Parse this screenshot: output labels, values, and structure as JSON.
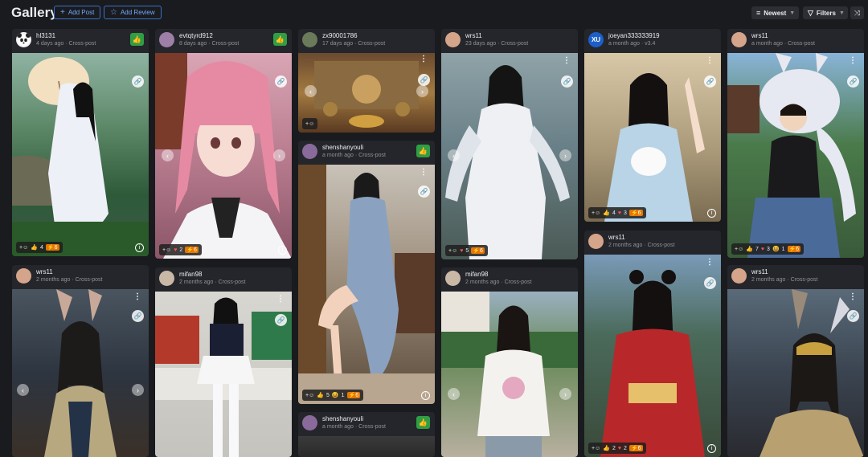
{
  "header": {
    "title": "Gallery",
    "add_post": "Add Post",
    "add_review": "Add Review",
    "sort": "Newest",
    "filters": "Filters"
  },
  "cards": [
    {
      "user": "hl3131",
      "meta": "4 days ago · Cross-post",
      "liked": true,
      "avatar": "panda-avatar",
      "reactions": {
        "thumbs": "4",
        "heart": "1",
        "buzz": "6"
      }
    },
    {
      "user": "evtqtyrd912",
      "meta": "8 days ago · Cross-post",
      "liked": true,
      "avatar": "portrait-avatar",
      "reactions": {
        "heart": "2",
        "buzz": "6"
      }
    },
    {
      "user": "zx90001786",
      "meta": "17 days ago · Cross-post",
      "liked": false,
      "avatar": "portrait-avatar",
      "reactions": {}
    },
    {
      "user": "shenshanyouli",
      "meta": "a month ago · Cross-post",
      "liked": true,
      "avatar": "portrait-avatar",
      "reactions": {
        "thumbs": "5",
        "laugh": "1",
        "buzz": "6"
      }
    },
    {
      "user": "shenshanyouli",
      "meta": "a month ago · Cross-post",
      "liked": true,
      "avatar": "portrait-avatar",
      "reactions": {}
    },
    {
      "user": "wrs11",
      "meta": "23 days ago · Cross-post",
      "liked": false,
      "avatar": "portrait-avatar",
      "reactions": {
        "heart": "5",
        "buzz": "6"
      }
    },
    {
      "user": "mifan98",
      "meta": "2 months ago · Cross-post",
      "liked": false,
      "avatar": "portrait-avatar",
      "reactions": {}
    },
    {
      "user": "joeyan333333919",
      "meta": "a month ago · v3.4",
      "liked": false,
      "avatar": "initials-avatar",
      "initials": "XU",
      "reactions": {
        "thumbs": "4",
        "heart": "3",
        "buzz": "6"
      }
    },
    {
      "user": "wrs11",
      "meta": "2 months ago · Cross-post",
      "liked": false,
      "avatar": "portrait-avatar",
      "reactions": {
        "thumbs": "2",
        "heart": "2",
        "buzz": "6"
      }
    },
    {
      "user": "wrs11",
      "meta": "a month ago · Cross-post",
      "liked": false,
      "avatar": "portrait-avatar",
      "reactions": {
        "thumbs": "7",
        "heart": "3",
        "laugh": "1",
        "buzz": "6"
      }
    },
    {
      "user": "wrs11",
      "meta": "2 months ago · Cross-post",
      "liked": false,
      "avatar": "portrait-avatar",
      "reactions": {}
    },
    {
      "user": "wrs11",
      "meta": "2 months ago · Cross-post",
      "liked": false,
      "avatar": "portrait-avatar",
      "reactions": {}
    },
    {
      "user": "mifan98",
      "meta": "2 months ago · Cross-post",
      "liked": false,
      "avatar": "portrait-avatar",
      "reactions": {}
    }
  ],
  "colors": {
    "background": "#1a1b1e",
    "card": "#25262b",
    "accent": "#3b6fc9",
    "like": "#2f9e44",
    "buzz": "#e67700"
  }
}
